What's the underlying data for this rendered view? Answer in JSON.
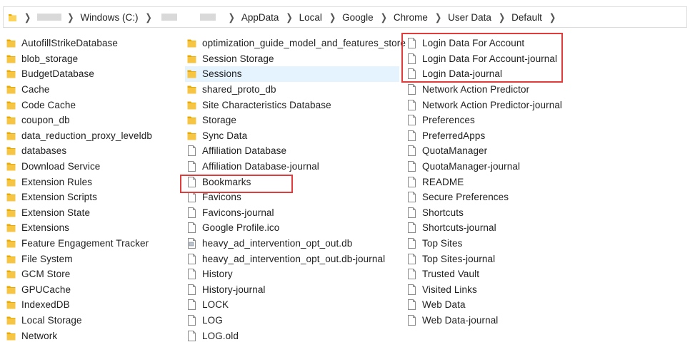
{
  "breadcrumb": {
    "segments": [
      "Windows (C:)",
      "AppData",
      "Local",
      "Google",
      "Chrome",
      "User Data",
      "Default"
    ]
  },
  "columns": [
    {
      "items": [
        {
          "name": "AutofillStrikeDatabase",
          "type": "folder"
        },
        {
          "name": "blob_storage",
          "type": "folder"
        },
        {
          "name": "BudgetDatabase",
          "type": "folder"
        },
        {
          "name": "Cache",
          "type": "folder"
        },
        {
          "name": "Code Cache",
          "type": "folder"
        },
        {
          "name": "coupon_db",
          "type": "folder"
        },
        {
          "name": "data_reduction_proxy_leveldb",
          "type": "folder"
        },
        {
          "name": "databases",
          "type": "folder"
        },
        {
          "name": "Download Service",
          "type": "folder"
        },
        {
          "name": "Extension Rules",
          "type": "folder"
        },
        {
          "name": "Extension Scripts",
          "type": "folder"
        },
        {
          "name": "Extension State",
          "type": "folder"
        },
        {
          "name": "Extensions",
          "type": "folder"
        },
        {
          "name": "Feature Engagement Tracker",
          "type": "folder"
        },
        {
          "name": "File System",
          "type": "folder"
        },
        {
          "name": "GCM Store",
          "type": "folder"
        },
        {
          "name": "GPUCache",
          "type": "folder"
        },
        {
          "name": "IndexedDB",
          "type": "folder"
        },
        {
          "name": "Local Storage",
          "type": "folder"
        },
        {
          "name": "Network",
          "type": "folder"
        }
      ]
    },
    {
      "items": [
        {
          "name": "optimization_guide_model_and_features_store",
          "type": "folder"
        },
        {
          "name": "Session Storage",
          "type": "folder"
        },
        {
          "name": "Sessions",
          "type": "folder",
          "state": "focused"
        },
        {
          "name": "shared_proto_db",
          "type": "folder"
        },
        {
          "name": "Site Characteristics Database",
          "type": "folder"
        },
        {
          "name": "Storage",
          "type": "folder"
        },
        {
          "name": "Sync Data",
          "type": "folder"
        },
        {
          "name": "Affiliation Database",
          "type": "file"
        },
        {
          "name": "Affiliation Database-journal",
          "type": "file"
        },
        {
          "name": "Bookmarks",
          "type": "file",
          "highlighted": true
        },
        {
          "name": "Favicons",
          "type": "file"
        },
        {
          "name": "Favicons-journal",
          "type": "file"
        },
        {
          "name": "Google Profile.ico",
          "type": "file"
        },
        {
          "name": "heavy_ad_intervention_opt_out.db",
          "type": "dbfile"
        },
        {
          "name": "heavy_ad_intervention_opt_out.db-journal",
          "type": "file"
        },
        {
          "name": "History",
          "type": "file"
        },
        {
          "name": "History-journal",
          "type": "file"
        },
        {
          "name": "LOCK",
          "type": "file"
        },
        {
          "name": "LOG",
          "type": "file"
        },
        {
          "name": "LOG.old",
          "type": "file"
        }
      ]
    },
    {
      "items": [
        {
          "name": "Login Data For Account",
          "type": "file",
          "highlighted": true
        },
        {
          "name": "Login Data For Account-journal",
          "type": "file",
          "highlighted": true
        },
        {
          "name": "Login Data-journal",
          "type": "file",
          "highlighted": true
        },
        {
          "name": "Network Action Predictor",
          "type": "file"
        },
        {
          "name": "Network Action Predictor-journal",
          "type": "file"
        },
        {
          "name": "Preferences",
          "type": "file"
        },
        {
          "name": "PreferredApps",
          "type": "file"
        },
        {
          "name": "QuotaManager",
          "type": "file"
        },
        {
          "name": "QuotaManager-journal",
          "type": "file"
        },
        {
          "name": "README",
          "type": "file"
        },
        {
          "name": "Secure Preferences",
          "type": "file"
        },
        {
          "name": "Shortcuts",
          "type": "file"
        },
        {
          "name": "Shortcuts-journal",
          "type": "file"
        },
        {
          "name": "Top Sites",
          "type": "file"
        },
        {
          "name": "Top Sites-journal",
          "type": "file"
        },
        {
          "name": "Trusted Vault",
          "type": "file"
        },
        {
          "name": "Visited Links",
          "type": "file"
        },
        {
          "name": "Web Data",
          "type": "file"
        },
        {
          "name": "Web Data-journal",
          "type": "file"
        }
      ]
    }
  ],
  "colors": {
    "folder": "#f7c544",
    "folder_dark": "#e8a900",
    "highlight": "#e23b3b",
    "focused_row": "#e5f3ff"
  }
}
